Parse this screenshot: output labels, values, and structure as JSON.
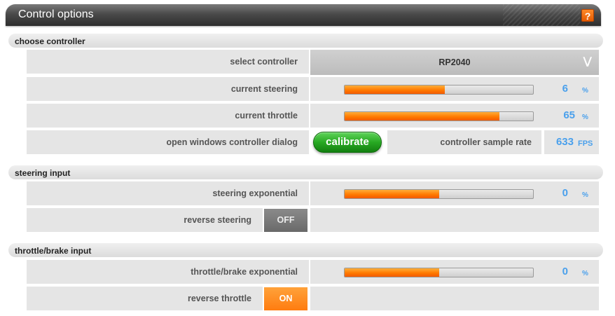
{
  "header": {
    "title": "Control options",
    "help_label": "?"
  },
  "sections": [
    {
      "title": "choose controller"
    },
    {
      "title": "steering input"
    },
    {
      "title": "throttle/brake input"
    }
  ],
  "choose_controller": {
    "select_label": "select controller",
    "select_value": "RP2040",
    "steering_label": "current steering",
    "steering_percent": 6,
    "steering_value": "6",
    "throttle_label": "current throttle",
    "throttle_percent": 65,
    "throttle_value": "65",
    "percent_unit": "%",
    "dialog_label": "open windows controller dialog",
    "calibrate_label": "calibrate",
    "sample_rate_label": "controller sample rate",
    "sample_rate_value": "633",
    "sample_rate_unit": "FPS"
  },
  "steering_input": {
    "exponential_label": "steering exponential",
    "exponential_level": 0.5,
    "exponential_value": "0",
    "percent_unit": "%",
    "reverse_label": "reverse steering",
    "reverse_state": "OFF"
  },
  "throttle_input": {
    "exponential_label": "throttle/brake exponential",
    "exponential_level": 0.5,
    "exponential_value": "0",
    "percent_unit": "%",
    "reverse_label": "reverse throttle",
    "reverse_state": "ON"
  },
  "colors": {
    "accent_orange": "#ff7a00",
    "value_blue": "#4aa0ec",
    "button_green": "#28a923"
  },
  "icons": {
    "select_arrow": "double-chevron-down-icon",
    "help": "help-icon"
  }
}
